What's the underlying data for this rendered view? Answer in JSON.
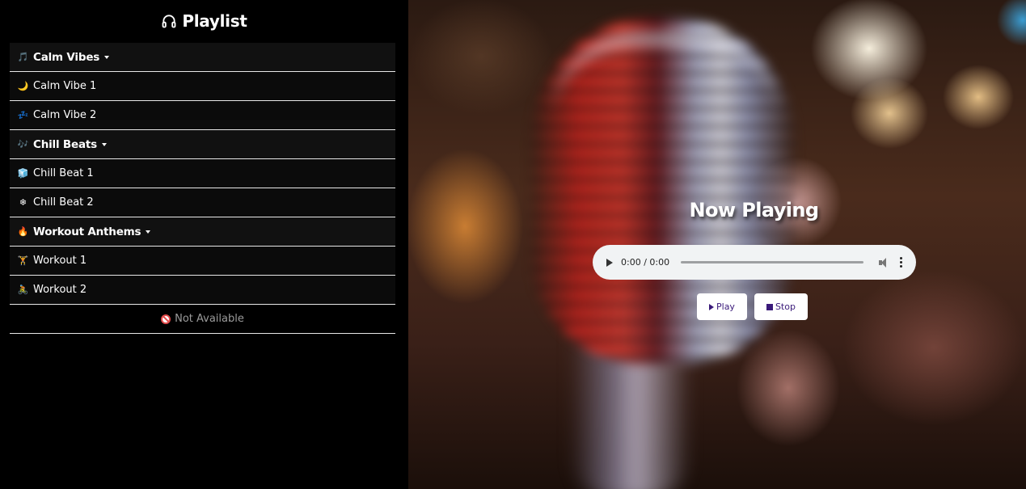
{
  "sidebar": {
    "title": "Playlist",
    "title_icon": "headphones-icon",
    "rows": [
      {
        "type": "group",
        "emoji": "🎵",
        "label": "Calm Vibes"
      },
      {
        "type": "item",
        "emoji": "🌙",
        "label": "Calm Vibe 1"
      },
      {
        "type": "item",
        "emoji": "💤",
        "label": "Calm Vibe 2"
      },
      {
        "type": "group",
        "emoji": "🎶",
        "label": "Chill Beats"
      },
      {
        "type": "item",
        "emoji": "🧊",
        "label": "Chill Beat 1"
      },
      {
        "type": "item",
        "emoji": "❄",
        "label": "Chill Beat 2"
      },
      {
        "type": "group",
        "emoji": "🔥",
        "label": "Workout Anthems"
      },
      {
        "type": "item",
        "emoji": "🏋",
        "label": "Workout 1"
      },
      {
        "type": "item",
        "emoji": "🚴",
        "label": "Workout 2"
      }
    ],
    "not_available": "Not Available"
  },
  "player": {
    "heading": "Now Playing",
    "time": "0:00 / 0:00",
    "play_label": "Play",
    "stop_label": "Stop"
  }
}
